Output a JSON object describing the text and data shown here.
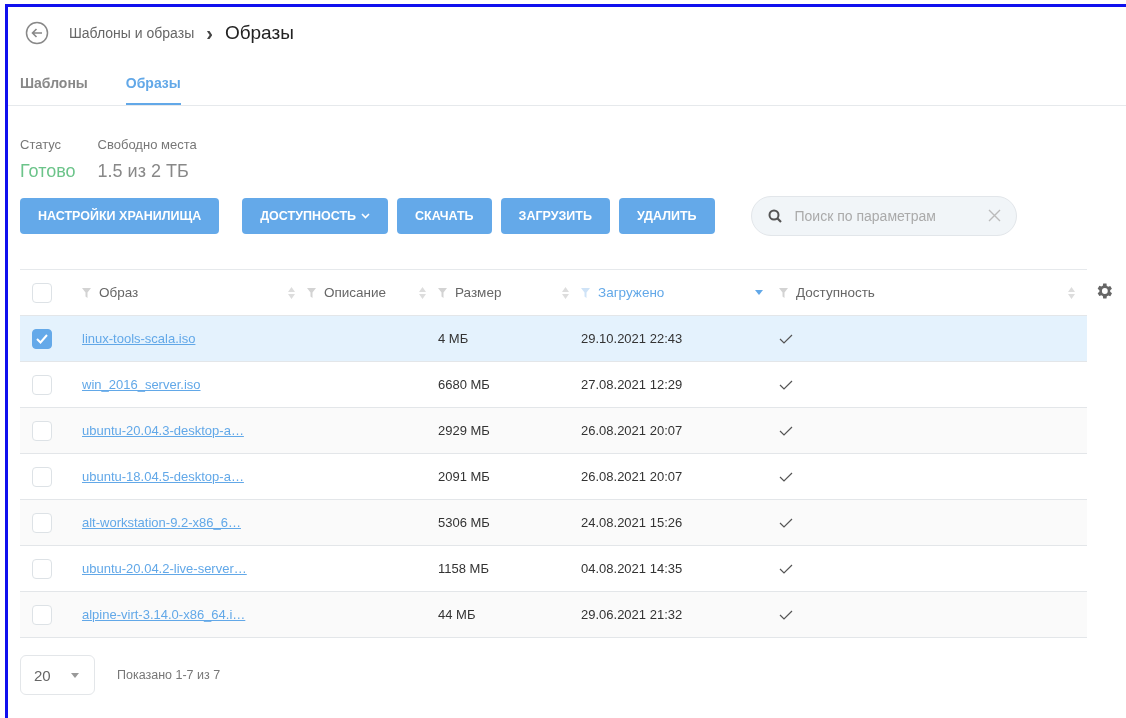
{
  "breadcrumb": {
    "parent": "Шаблоны и образы",
    "separator": "›",
    "current": "Образы"
  },
  "tabs": [
    {
      "label": "Шаблоны",
      "selected": false
    },
    {
      "label": "Образы",
      "selected": true
    }
  ],
  "info": [
    {
      "label": "Статус",
      "value": "Готово",
      "kind": "status"
    },
    {
      "label": "Свободно места",
      "value": "1.5 из 2 ТБ",
      "kind": "plain"
    }
  ],
  "buttons": [
    {
      "label": "НАСТРОЙКИ ХРАНИЛИЩА",
      "dropdown": false
    },
    {
      "label": "ДОСТУПНОСТЬ",
      "dropdown": true
    },
    {
      "label": "СКАЧАТЬ",
      "dropdown": false
    },
    {
      "label": "ЗАГРУЗИТЬ",
      "dropdown": false
    },
    {
      "label": "УДАЛИТЬ",
      "dropdown": false
    }
  ],
  "search": {
    "placeholder": "Поиск по параметрам"
  },
  "table": {
    "all_checked": false,
    "columns": [
      {
        "label": "Образ",
        "sorted": false
      },
      {
        "label": "Описание",
        "sorted": false
      },
      {
        "label": "Размер",
        "sorted": false
      },
      {
        "label": "Загружено",
        "sorted": true
      },
      {
        "label": "Доступность",
        "sorted": false
      }
    ],
    "rows": [
      {
        "name": "linux-tools-scala.iso",
        "size": "4 МБ",
        "uploaded": "29.10.2021 22:43",
        "available": true,
        "selected": true
      },
      {
        "name": "win_2016_server.iso",
        "size": "6680 МБ",
        "uploaded": "27.08.2021 12:29",
        "available": true,
        "selected": false
      },
      {
        "name": "ubuntu-20.04.3-desktop-a…",
        "size": "2929 МБ",
        "uploaded": "26.08.2021 20:07",
        "available": true,
        "selected": false
      },
      {
        "name": "ubuntu-18.04.5-desktop-a…",
        "size": "2091 МБ",
        "uploaded": "26.08.2021 20:07",
        "available": true,
        "selected": false
      },
      {
        "name": "alt-workstation-9.2-x86_6…",
        "size": "5306 МБ",
        "uploaded": "24.08.2021 15:26",
        "available": true,
        "selected": false
      },
      {
        "name": "ubuntu-20.04.2-live-server…",
        "size": "1158 МБ",
        "uploaded": "04.08.2021 14:35",
        "available": true,
        "selected": false
      },
      {
        "name": "alpine-virt-3.14.0-x86_64.i…",
        "size": "44 МБ",
        "uploaded": "29.06.2021 21:32",
        "available": true,
        "selected": false
      }
    ]
  },
  "pagination": {
    "page_size": "20",
    "summary": "Показано 1-7 из 7"
  }
}
